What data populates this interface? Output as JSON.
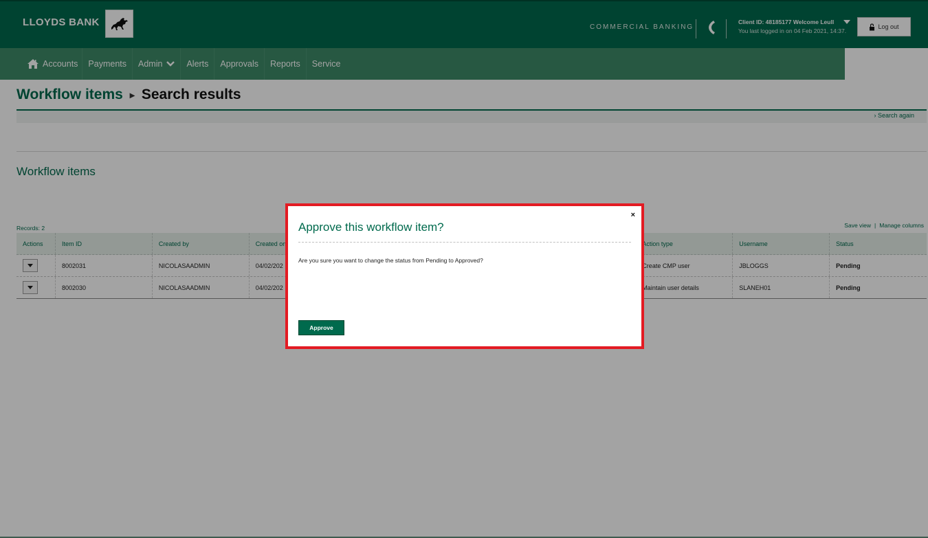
{
  "header": {
    "brand": "LLOYDS BANK",
    "division": "COMMERCIAL BANKING",
    "client_line": "Client ID: 48185177 Welcome Leull",
    "last_login": "You last logged in on 04 Feb 2021, 14:37.",
    "logout_label": "Log out"
  },
  "nav": {
    "items": [
      "Accounts",
      "Payments",
      "Admin",
      "Alerts",
      "Approvals",
      "Reports",
      "Service"
    ]
  },
  "breadcrumb": {
    "parent": "Workflow items",
    "current": "Search results"
  },
  "search_again": "Search again",
  "section_title": "Workflow items",
  "records": "Records: 2",
  "table_links": {
    "save_view": "Save view",
    "separator": "|",
    "manage_columns": "Manage columns"
  },
  "table": {
    "columns": [
      "Actions",
      "Item ID",
      "Created by",
      "Created on",
      "",
      "",
      "",
      "Action type",
      "Username",
      "Status"
    ],
    "rows": [
      {
        "item_id": "8002031",
        "created_by": "NICOLASAADMIN",
        "created_on": "04/02/202",
        "action_type": "Create CMP user",
        "username": "JBLOGGS",
        "status": "Pending"
      },
      {
        "item_id": "8002030",
        "created_by": "NICOLASAADMIN",
        "created_on": "04/02/202",
        "action_type": "Maintain user details",
        "username": "SLANEH01",
        "status": "Pending"
      }
    ]
  },
  "modal": {
    "close": "×",
    "title": "Approve this workflow item?",
    "message": "Are you sure you want to change the status from Pending to Approved?",
    "approve_label": "Approve"
  },
  "colors": {
    "brand_green": "#006a4d",
    "nav_green": "#3e8a68",
    "highlight_red": "#e31b23"
  },
  "icons": {
    "logo": "black-horse-logo",
    "phone": "phone-icon",
    "home": "home-icon",
    "lock": "padlock-icon",
    "admin_dropdown": "chevron-down-icon",
    "row_action": "caret-down-icon"
  }
}
